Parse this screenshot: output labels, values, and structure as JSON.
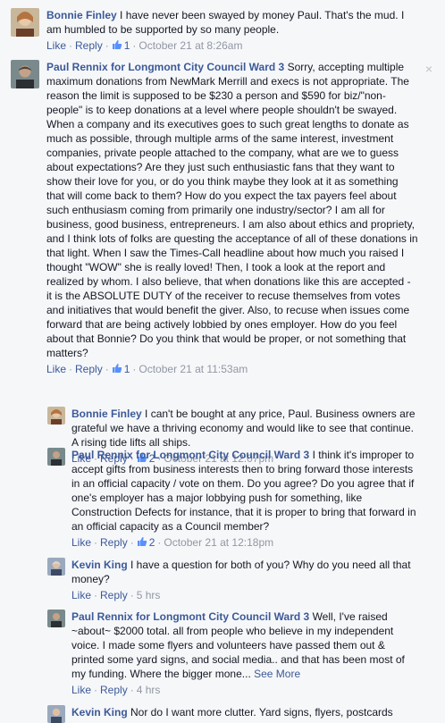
{
  "comments": [
    {
      "author": "Bonnie Finley",
      "text": " I have never been swayed by money Paul. That's the mud. I am humbled to be supported by so many people.",
      "like": "Like",
      "reply": "Reply",
      "likes": "1",
      "time": "October 21 at 8:26am"
    },
    {
      "author": "Paul Rennix for Longmont City Council Ward 3",
      "text": " Sorry, accepting multiple maximum donations from NewMark Merrill and execs is not appropriate. The reason the limit is supposed to be $230 a person and $590 for biz/\"non-people\" is to keep donations at a level where people shouldn't be swayed. When a company and its executives goes to such great lengths to donate as much as possible, through multiple arms of the same interest, investment companies, private people attached to the company, what are we to guess about expectations? Are they just such enthusiastic fans that they want to show their love for you, or do you think maybe they look at it as something that will come back to them? How do you expect the tax payers feel about such enthusiasm coming from primarily one industry/sector? I am all for business, good business, entrepreneurs. I am also about ethics and propriety, and I think lots of folks are questing the acceptance of all of these donations in that light. When I saw the Times-Call headline about how much you raised I thought \"WOW\" she is really loved! Then, I took a look at the report and realized by whom. I also believe, that when donations like this are accepted - it is the ABSOLUTE DUTY of the receiver to recuse themselves from votes and initiatives that would benefit the giver. Also, to recuse when issues come forward that are being actively lobbied by ones employer. How do you feel about that Bonnie? Do you think that would be proper, or not something that matters?",
      "like": "Like",
      "reply": "Reply",
      "likes": "1",
      "time": "October 21 at 11:53am",
      "close": "×"
    }
  ],
  "replies": [
    {
      "author": "Bonnie Finley",
      "text": " I can't be bought at any price, Paul. Business owners are grateful we have a thriving economy and would like to see that continue. A rising tide lifts all ships.",
      "like": "Like",
      "reply": "Reply",
      "likes": "2",
      "time": "October 21 at 12:07pm"
    },
    {
      "author": "Paul Rennix for Longmont City Council Ward 3",
      "text": " I think it's improper to accept gifts from business interests then to bring forward those interests in an official capacity / vote on them. Do you agree? Do you agree that if one's employer has a major lobbying push for something, like Construction Defects for instance, that it is proper to bring that forward in an official capacity as a Council member?",
      "like": "Like",
      "reply": "Reply",
      "likes": "2",
      "time": "October 21 at 12:18pm"
    },
    {
      "author": "Kevin King",
      "text": " I have a question for both of you? Why do you need all that money?",
      "like": "Like",
      "reply": "Reply",
      "time": "5 hrs"
    },
    {
      "author": "Paul Rennix for Longmont City Council Ward 3",
      "text": " Well, I've raised ~about~ $2000 total. all from people who believe in my independent voice. I made some flyers and volunteers have passed them out & printed some yard signs, and social media.. and that has been most of my funding. Where the bigger mone...",
      "see_more": " See More",
      "like": "Like",
      "reply": "Reply",
      "time": "4 hrs"
    },
    {
      "author": "Kevin King",
      "text": " Nor do I want more clutter. Yard signs, flyers, postcards"
    }
  ],
  "colors": {
    "link": "#3b5998",
    "meta": "#9197a3",
    "background": "#f6f7f9"
  }
}
